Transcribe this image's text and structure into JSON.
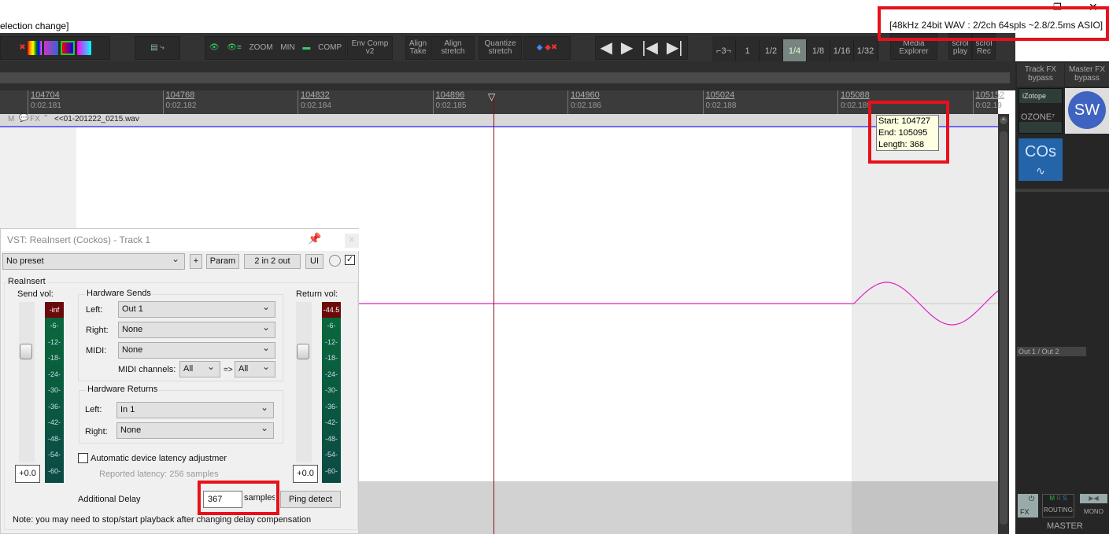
{
  "window": {
    "title_fragment": "election change]",
    "status": "[48kHz 24bit WAV : 2/2ch 64spls ~2.8/2.5ms ASIO]",
    "restore_icon": "restore-icon",
    "close_icon": "close-icon"
  },
  "toolbar": {
    "env_comp": "Env Comp v2",
    "align_take": "Align Take",
    "align_stretch": "Align stretch",
    "quantize_stretch": "Quantize stretch",
    "zoom": "ZOOM",
    "min": "MIN",
    "comp": "COMP",
    "triplet": "⌐3¬",
    "grid": [
      "1",
      "1/2",
      "1/4",
      "1/8",
      "1/16",
      "1/32"
    ],
    "grid_active": "1/4",
    "media_explorer": "Media Explorer",
    "scroll_play": "scrol play",
    "scroll_rec": "scrol Rec"
  },
  "ruler": {
    "ticks": [
      {
        "samples": "104704",
        "time": "0:02.181"
      },
      {
        "samples": "104768",
        "time": "0:02.182"
      },
      {
        "samples": "104832",
        "time": "0:02.184"
      },
      {
        "samples": "104896",
        "time": "0:02.185"
      },
      {
        "samples": "104960",
        "time": "0:02.186"
      },
      {
        "samples": "105024",
        "time": "0:02.188"
      },
      {
        "samples": "105088",
        "time": "0:02.189"
      },
      {
        "samples": "105152",
        "time": "0:02.19"
      }
    ]
  },
  "track": {
    "m": "M",
    "fx": "FX",
    "item_name": "<<01-201222_0215.wav"
  },
  "tooltip": {
    "start": "Start: 104727",
    "end": "End: 105095",
    "length": "Length: 368"
  },
  "mixer": {
    "track_fx_bypass": "Track FX bypass",
    "master_fx_bypass": "Master FX bypass",
    "izotope": "iZotope",
    "ozone": "OZONE⁷",
    "sw": "SW",
    "cos": "COs",
    "output": "Out 1 / Out 2",
    "fx": "FX",
    "routing": "ROUTING",
    "m": "M",
    "r": "R",
    "s": "S",
    "mono": "MONO",
    "master": "MASTER"
  },
  "plugin": {
    "title": "VST: ReaInsert (Cockos) - Track 1",
    "preset": "No preset",
    "plus": "+",
    "param": "Param",
    "io": "2 in 2 out",
    "ui": "UI",
    "enabled": true,
    "group": "ReaInsert",
    "send_vol": "Send vol:",
    "return_vol": "Return vol:",
    "send_peak": "-inf",
    "return_peak": "-44.5",
    "meter_marks": [
      "-6-",
      "-12-",
      "-18-",
      "-24-",
      "-30-",
      "-36-",
      "-42-",
      "-48-",
      "-54-",
      "-60-"
    ],
    "send_value": "+0.0",
    "return_value": "+0.0",
    "hw_sends": {
      "title": "Hardware Sends",
      "left_label": "Left:",
      "left": "Out 1",
      "right_label": "Right:",
      "right": "None",
      "midi_label": "MIDI:",
      "midi": "None",
      "midi_channels_label": "MIDI channels:",
      "ch_from": "All",
      "arrow": "=>",
      "ch_to": "All"
    },
    "hw_returns": {
      "title": "Hardware Returns",
      "left_label": "Left:",
      "left": "In 1",
      "right_label": "Right:",
      "right": "None"
    },
    "auto_latency": "Automatic device latency adjustmer",
    "auto_latency_checked": false,
    "reported_latency": "Reported latency: 256 samples",
    "additional_delay": "Additional Delay",
    "delay_value": "367",
    "delay_unit": "samples",
    "ping_detect": "Ping detect",
    "note": "Note: you may need to stop/start playback after changing delay compensation"
  }
}
